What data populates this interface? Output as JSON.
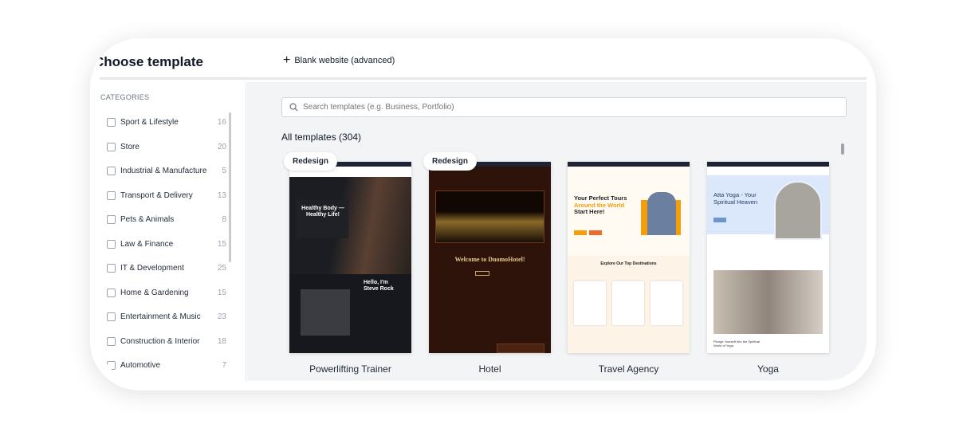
{
  "header": {
    "title": "Choose template",
    "blank_label": "Blank website (advanced)"
  },
  "sidebar": {
    "heading": "CATEGORIES",
    "items": [
      {
        "label": "Sport & Lifestyle",
        "count": "16"
      },
      {
        "label": "Store",
        "count": "20"
      },
      {
        "label": "Industrial & Manufacture",
        "count": "5"
      },
      {
        "label": "Transport & Delivery",
        "count": "13"
      },
      {
        "label": "Pets & Animals",
        "count": "8"
      },
      {
        "label": "Law & Finance",
        "count": "15"
      },
      {
        "label": "IT & Development",
        "count": "25"
      },
      {
        "label": "Home & Gardening",
        "count": "15"
      },
      {
        "label": "Entertainment & Music",
        "count": "23"
      },
      {
        "label": "Construction & Interior",
        "count": "18"
      },
      {
        "label": "Automotive",
        "count": "7"
      }
    ]
  },
  "search": {
    "placeholder": "Search templates (e.g. Business, Portfolio)",
    "value": ""
  },
  "templates_heading": "All templates (304)",
  "templates": [
    {
      "name": "Powerlifting Trainer",
      "badge": "Redesign",
      "hero": "Healthy Body — Healthy Life!",
      "sub": "Hello, I'm Steve Rock"
    },
    {
      "name": "Hotel",
      "badge": "Redesign",
      "hero": "Welcome to DuomoHotel!"
    },
    {
      "name": "Travel Agency",
      "hero_a": "Your Perfect Tours",
      "hero_b": "Around the World",
      "hero_c": "Start Here!",
      "sub": "Explore Our Top Destinations"
    },
    {
      "name": "Yoga",
      "hero": "Atta Yoga - Your Spiritual Heaven",
      "sub": "Plunge Yourself Into the Spiritual World of Yoga"
    }
  ],
  "colors": {
    "accent_orange": "#f59e0b",
    "hotel_bg": "#2e130a",
    "yoga_bg": "#dbe8fb",
    "dark": "#16181d"
  }
}
